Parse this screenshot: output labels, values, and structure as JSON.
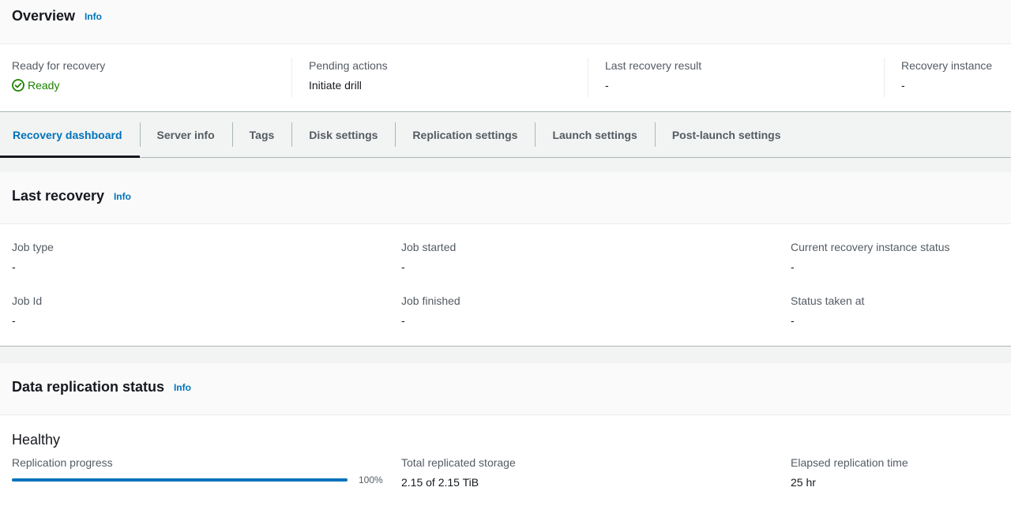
{
  "overview": {
    "title": "Overview",
    "info": "Info",
    "ready_label": "Ready for recovery",
    "ready_value": "Ready",
    "pending_label": "Pending actions",
    "pending_value": "Initiate drill",
    "last_result_label": "Last recovery result",
    "last_result_value": "-",
    "instance_label": "Recovery instance",
    "instance_value": "-"
  },
  "tabs": [
    {
      "label": "Recovery dashboard"
    },
    {
      "label": "Server info"
    },
    {
      "label": "Tags"
    },
    {
      "label": "Disk settings"
    },
    {
      "label": "Replication settings"
    },
    {
      "label": "Launch settings"
    },
    {
      "label": "Post-launch settings"
    }
  ],
  "last_recovery": {
    "title": "Last recovery",
    "info": "Info",
    "job_type_label": "Job type",
    "job_type_value": "-",
    "job_started_label": "Job started",
    "job_started_value": "-",
    "instance_status_label": "Current recovery instance status",
    "instance_status_value": "-",
    "job_id_label": "Job Id",
    "job_id_value": "-",
    "job_finished_label": "Job finished",
    "job_finished_value": "-",
    "status_taken_label": "Status taken at",
    "status_taken_value": "-"
  },
  "replication": {
    "title": "Data replication status",
    "info": "Info",
    "health": "Healthy",
    "progress_label": "Replication progress",
    "progress_percent": 100,
    "progress_text": "100%",
    "storage_label": "Total replicated storage",
    "storage_value": "2.15 of 2.15 TiB",
    "elapsed_label": "Elapsed replication time",
    "elapsed_value": "25 hr"
  },
  "colors": {
    "accent": "#0073bb",
    "success": "#1d8102",
    "text": "#16191f",
    "label": "#545b64"
  }
}
